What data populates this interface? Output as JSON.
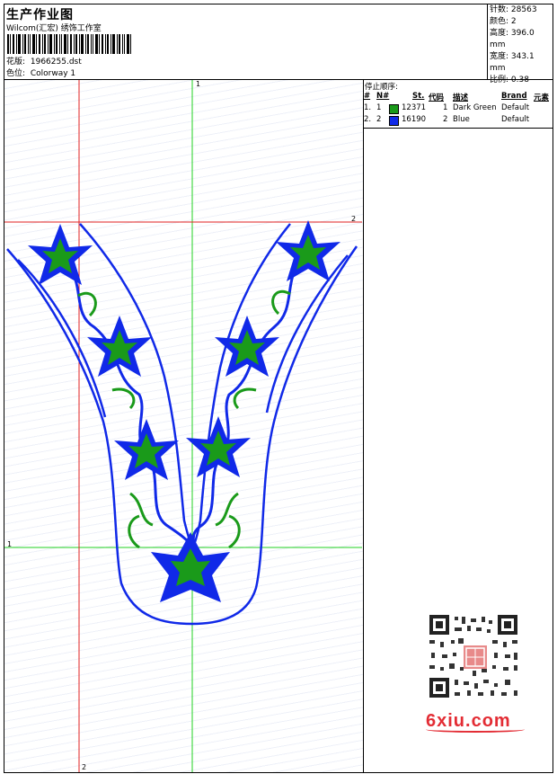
{
  "header": {
    "title": "生产作业图",
    "company": "Wilcom(汇宏) 绣饰工作室",
    "design_label": "花版:",
    "design_value": "1966255.dst",
    "colorway_label": "色位:",
    "colorway_value": "Colorway 1"
  },
  "stats": {
    "stitches_label": "针数:",
    "stitches_value": "28563",
    "colors_label": "颜色:",
    "colors_value": "2",
    "height_label": "高度:",
    "height_value": "396.0 mm",
    "width_label": "宽度:",
    "width_value": "343.1 mm",
    "scale_label": "比例:",
    "scale_value": "0.38"
  },
  "sequence": {
    "title": "停止顺序:",
    "headers": [
      "#",
      "N#",
      "St.",
      "代码",
      "描述",
      "Brand",
      "元素"
    ],
    "rows": [
      {
        "idx": "1.",
        "n": "1",
        "swatch": "#1a9a1a",
        "st": "12371",
        "code": "1",
        "desc": "Dark Green",
        "brand": "Default"
      },
      {
        "idx": "2.",
        "n": "2",
        "swatch": "#1029e8",
        "st": "16190",
        "code": "2",
        "desc": "Blue",
        "brand": "Default"
      }
    ]
  },
  "guides": {
    "v_green_label": "1",
    "h_red_label": "2",
    "h_green_label": "1",
    "v_red_label": "2"
  },
  "colors": {
    "thread_green": "#1a9a1a",
    "thread_blue": "#1029e8",
    "guide_red": "#e02020",
    "guide_green": "#20d020"
  },
  "watermark": {
    "text": "6xiu.com"
  }
}
